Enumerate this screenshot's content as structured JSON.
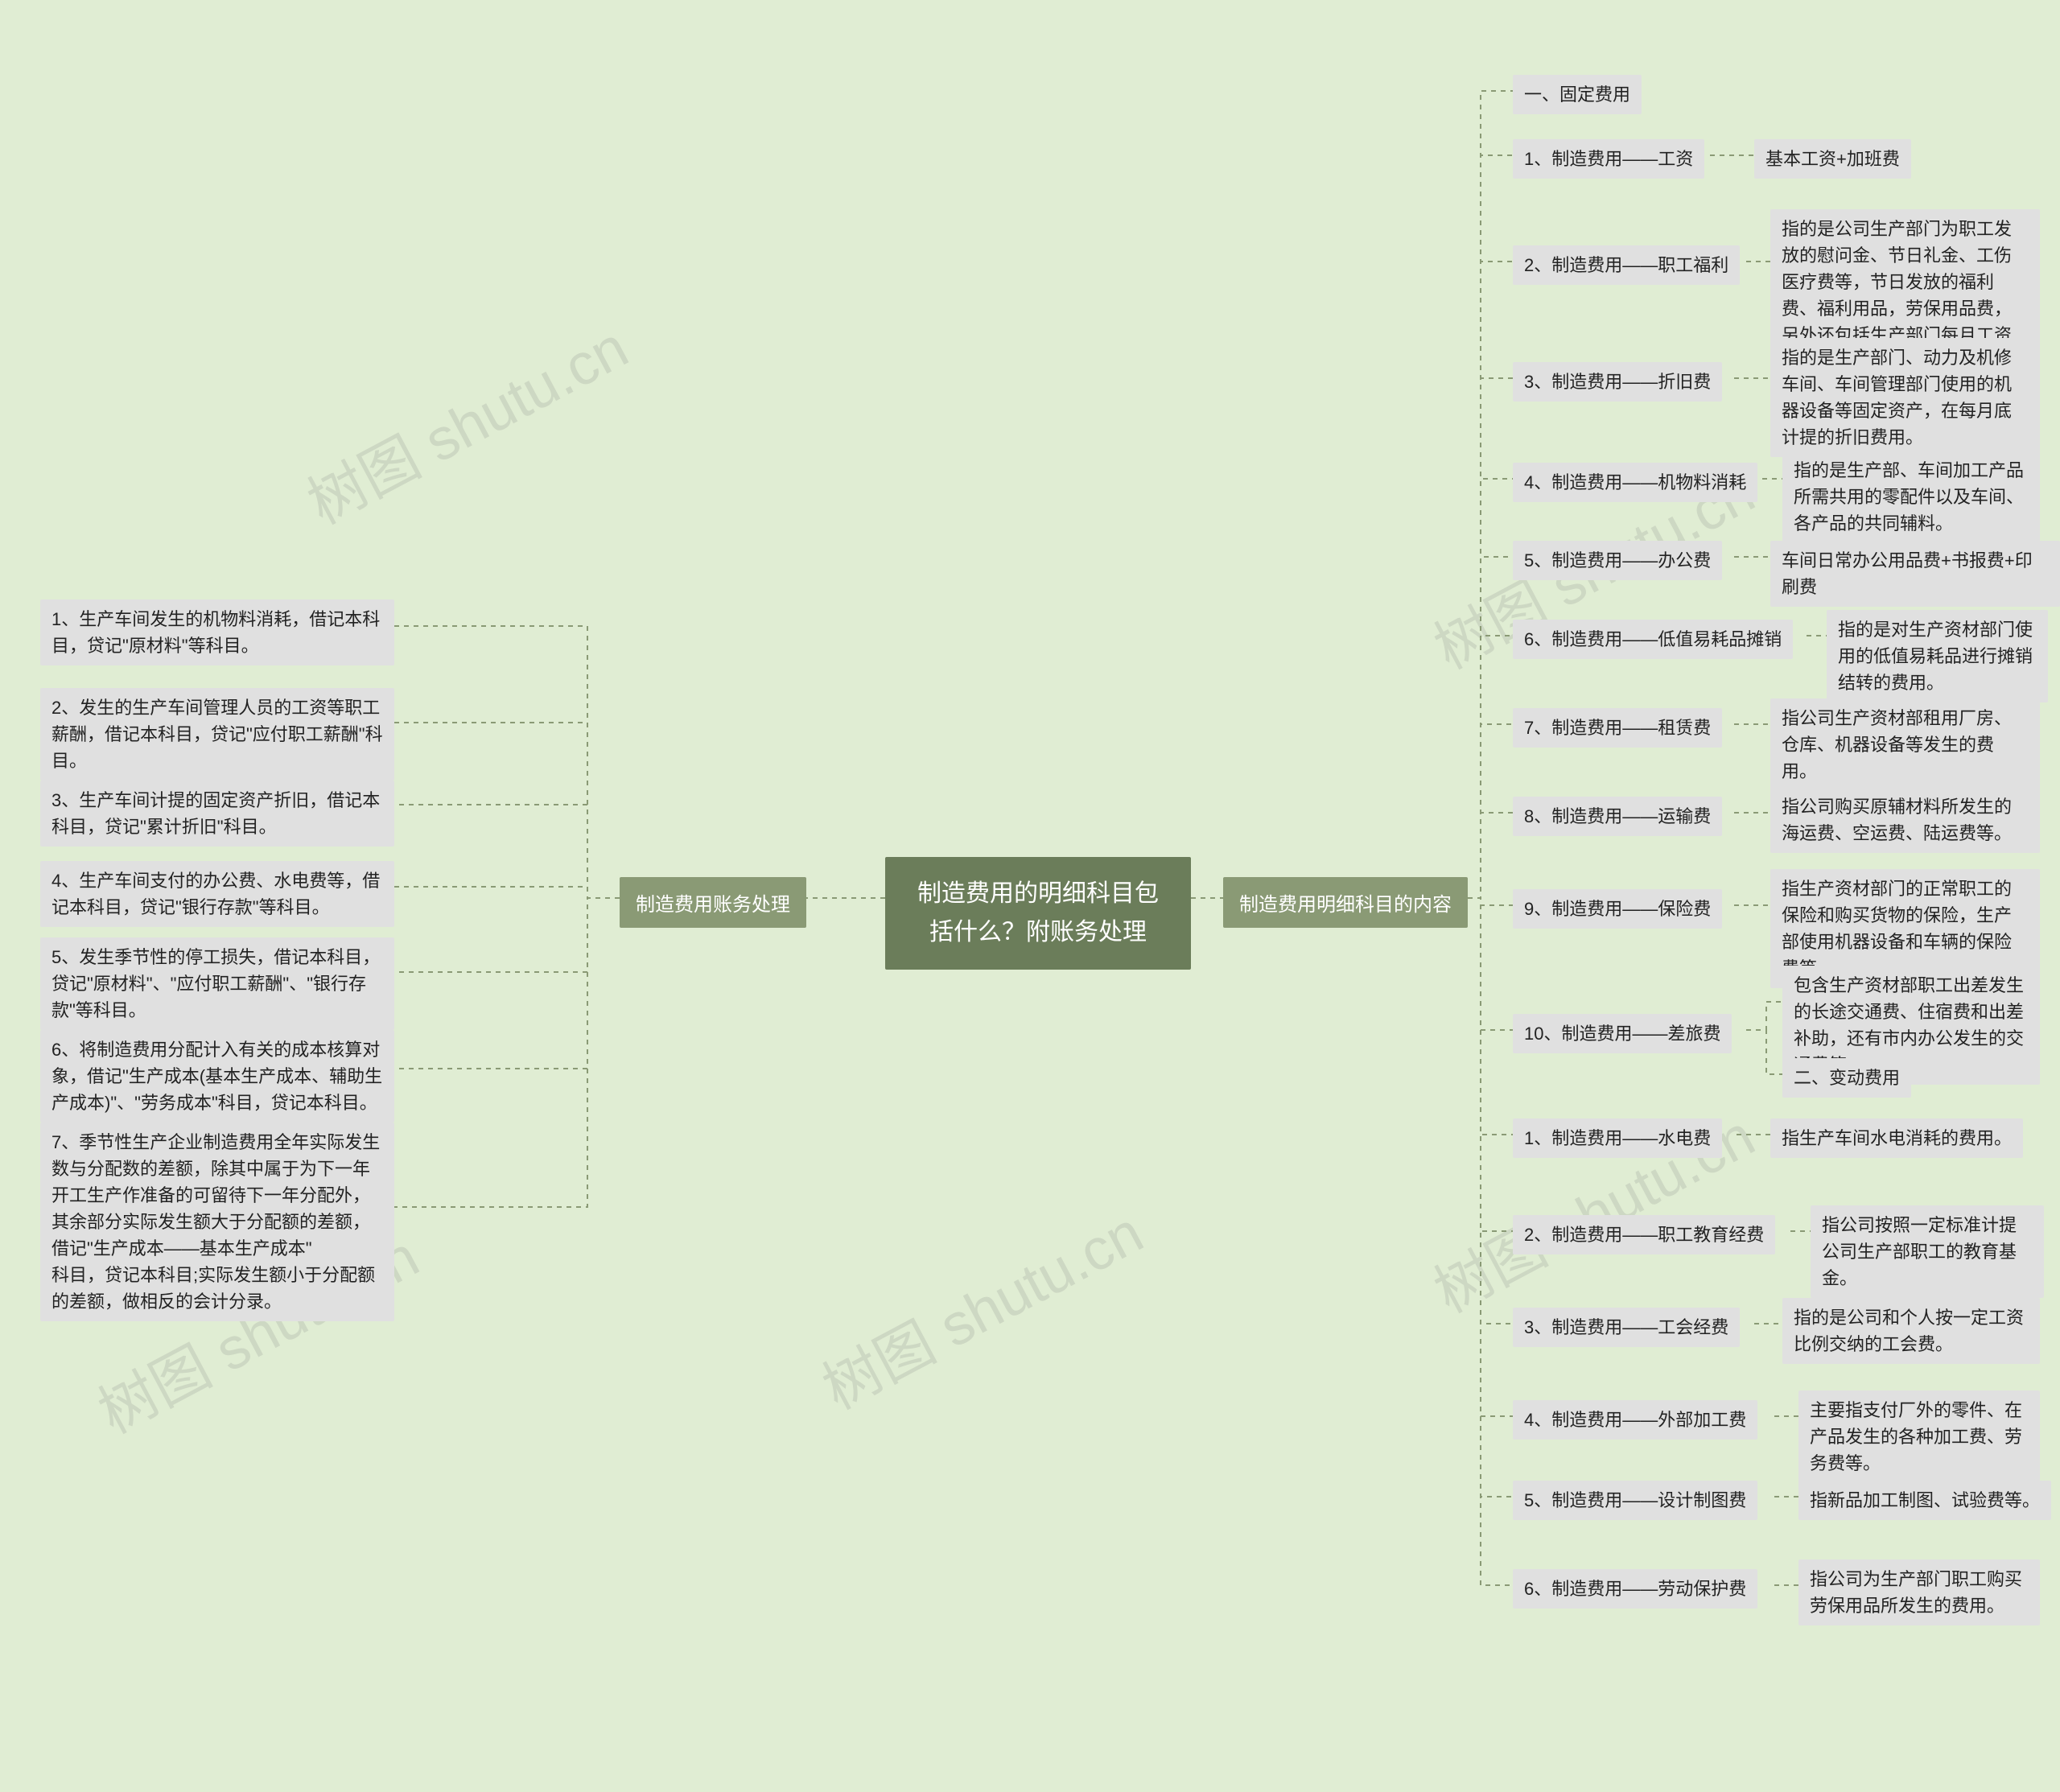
{
  "watermark": "树图 shutu.cn",
  "root": "制造费用的明细科目包括什么？附账务处理",
  "left_branch": "制造费用账务处理",
  "right_branch": "制造费用明细科目的内容",
  "left": {
    "i1": "1、生产车间发生的机物料消耗，借记本科目，贷记\"原材料\"等科目。",
    "i2": "2、发生的生产车间管理人员的工资等职工薪酬，借记本科目，贷记\"应付职工薪酬\"科目。",
    "i3": "3、生产车间计提的固定资产折旧，借记本科目，贷记\"累计折旧\"科目。",
    "i4": "4、生产车间支付的办公费、水电费等，借记本科目，贷记\"银行存款\"等科目。",
    "i5": "5、发生季节性的停工损失，借记本科目，贷记\"原材料\"、\"应付职工薪酬\"、\"银行存款\"等科目。",
    "i6": "6、将制造费用分配计入有关的成本核算对象，借记\"生产成本(基本生产成本、辅助生产成本)\"、\"劳务成本\"科目，贷记本科目。",
    "i7": "7、季节性生产企业制造费用全年实际发生数与分配数的差额，除其中属于为下一年开工生产作准备的可留待下一年分配外，其余部分实际发生额大于分配额的差额，借记\"生产成本——基本生产成本\"\n科目，贷记本科目;实际发生额小于分配额的差额，做相反的会计分录。"
  },
  "right": {
    "heading1": "一、固定费用",
    "r1": {
      "label": "1、制造费用——工资",
      "desc": "基本工资+加班费"
    },
    "r2": {
      "label": "2、制造费用——职工福利",
      "desc": "指的是公司生产部门为职工发放的慰问金、节日礼金、工伤医疗费等，节日发放的福利费、福利用品，劳保用品费，另外还包括生产部门每月工资计提的福利费。"
    },
    "r3": {
      "label": "3、制造费用——折旧费",
      "desc": "指的是生产部门、动力及机修车间、车间管理部门使用的机器设备等固定资产，在每月底计提的折旧费用。"
    },
    "r4": {
      "label": "4、制造费用——机物料消耗",
      "desc": "指的是生产部、车间加工产品所需共用的零配件以及车间、各产品的共同辅料。"
    },
    "r5": {
      "label": "5、制造费用——办公费",
      "desc": "车间日常办公用品费+书报费+印刷费"
    },
    "r6": {
      "label": "6、制造费用——低值易耗品摊销",
      "desc": "指的是对生产资材部门使用的低值易耗品进行摊销结转的费用。"
    },
    "r7": {
      "label": "7、制造费用——租赁费",
      "desc": "指公司生产资材部租用厂房、仓库、机器设备等发生的费用。"
    },
    "r8": {
      "label": "8、制造费用——运输费",
      "desc": "指公司购买原辅材料所发生的海运费、空运费、陆运费等。"
    },
    "r9": {
      "label": "9、制造费用——保险费",
      "desc": "指生产资材部门的正常职工的保险和购买货物的保险，生产部使用机器设备和车辆的保险费等。"
    },
    "r10": {
      "label": "10、制造费用——差旅费",
      "desc": "包含生产资材部职工出差发生的长途交通费、住宿费和出差补助，还有市内办公发生的交通费等。"
    },
    "heading2": "二、变动费用",
    "v1": {
      "label": "1、制造费用——水电费",
      "desc": "指生产车间水电消耗的费用。"
    },
    "v2": {
      "label": "2、制造费用——职工教育经费",
      "desc": "指公司按照一定标准计提公司生产部职工的教育基金。"
    },
    "v3": {
      "label": "3、制造费用——工会经费",
      "desc": "指的是公司和个人按一定工资比例交纳的工会费。"
    },
    "v4": {
      "label": "4、制造费用——外部加工费",
      "desc": "主要指支付厂外的零件、在产品发生的各种加工费、劳务费等。"
    },
    "v5": {
      "label": "5、制造费用——设计制图费",
      "desc": "指新品加工制图、试验费等。"
    },
    "v6": {
      "label": "6、制造费用——劳动保护费",
      "desc": "指公司为生产部门职工购买劳保用品所发生的费用。"
    }
  }
}
